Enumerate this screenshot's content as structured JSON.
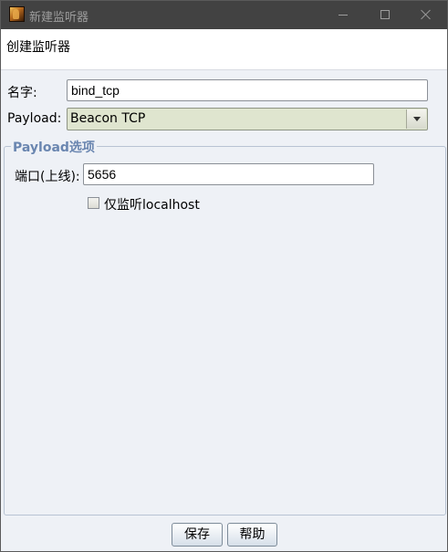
{
  "window": {
    "title": "新建监听器"
  },
  "icons": {
    "app": "app-icon",
    "minimize": "minimize-icon",
    "maximize": "maximize-icon",
    "close": "close-icon",
    "dropdown": "chevron-down-icon"
  },
  "header": {
    "title": "创建监听器"
  },
  "form": {
    "name_label": "名字:",
    "name_value": "bind_tcp",
    "payload_label": "Payload:",
    "payload_value": "Beacon TCP"
  },
  "options": {
    "group_title": "Payload选项",
    "port_label": "端口(上线):",
    "port_value": "5656",
    "localhost_only_label": "仅监听localhost",
    "localhost_only_checked": false
  },
  "buttons": {
    "save": "保存",
    "help": "帮助"
  }
}
